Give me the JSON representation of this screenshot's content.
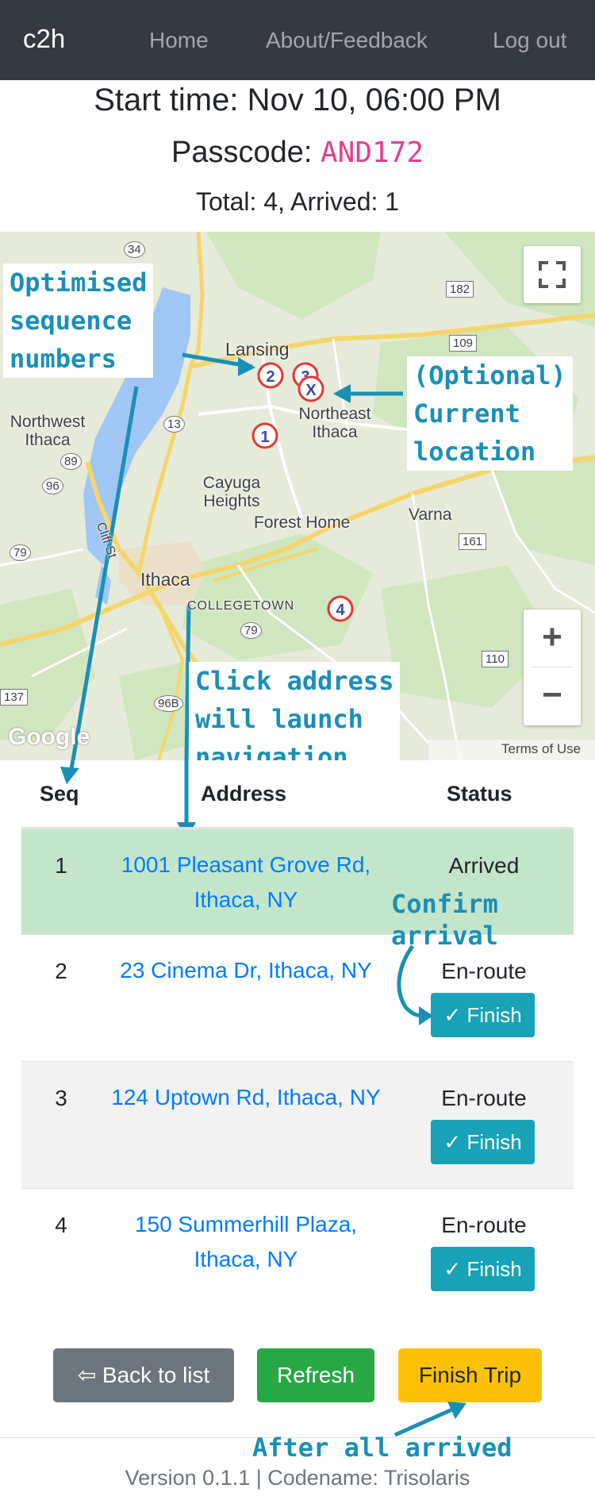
{
  "navbar": {
    "brand": "c2h",
    "links": [
      "Home",
      "About/Feedback",
      "Log out"
    ]
  },
  "trip": {
    "start_time": "Start time: Nov 10, 06:00 PM",
    "passcode_label": "Passcode: ",
    "passcode": "AND172",
    "totals": "Total: 4, Arrived: 1"
  },
  "map": {
    "place_labels": [
      "Lansing",
      "Northwest Ithaca",
      "Northeast Ithaca",
      "Cayuga Heights",
      "Forest Home",
      "Varna",
      "Ithaca",
      "COLLEGETOWN",
      "Cliff St"
    ],
    "route_shields": [
      "34",
      "182",
      "109",
      "13",
      "89",
      "96",
      "79",
      "161",
      "79",
      "110",
      "96B",
      "137"
    ],
    "markers": [
      "1",
      "2",
      "3",
      "4",
      "X"
    ],
    "attribution": [
      "Google",
      "Terms of Use"
    ],
    "zoom_in": "+",
    "zoom_out": "−",
    "fullscreen_icon": "fullscreen-icon"
  },
  "annotations": {
    "sequence": "Optimised\nsequence\nnumbers",
    "location": "(Optional)\nCurrent\nlocation",
    "address": "Click address\nwill launch\nnavigation",
    "confirm": "Confirm\narrival",
    "after": "After all arrived"
  },
  "table": {
    "headers": [
      "Seq",
      "Address",
      "Status"
    ],
    "rows": [
      {
        "seq": "1",
        "address": "1001 Pleasant Grove Rd, Ithaca, NY",
        "status": "Arrived"
      },
      {
        "seq": "2",
        "address": "23 Cinema Dr, Ithaca, NY",
        "status": "En-route",
        "button": "✓ Finish"
      },
      {
        "seq": "3",
        "address": "124 Uptown Rd, Ithaca, NY",
        "status": "En-route",
        "button": "✓ Finish"
      },
      {
        "seq": "4",
        "address": "150 Summerhill Plaza, Ithaca, NY",
        "status": "En-route",
        "button": "✓ Finish"
      }
    ],
    "arrived_color": "#c3e6cb",
    "stripe_color": "#f2f2f2"
  },
  "actions": {
    "back": "⇦ Back to list",
    "refresh": "Refresh",
    "finish_trip": "Finish Trip"
  },
  "footer": "Version 0.1.1 | Codename: Trisolaris",
  "colors": {
    "navbar": "#343a40",
    "link": "#007bff",
    "info": "#17a2b8",
    "success": "#28a745",
    "warning": "#ffc107",
    "secondary": "#6c757d",
    "annotation": "#1a8fb5"
  }
}
